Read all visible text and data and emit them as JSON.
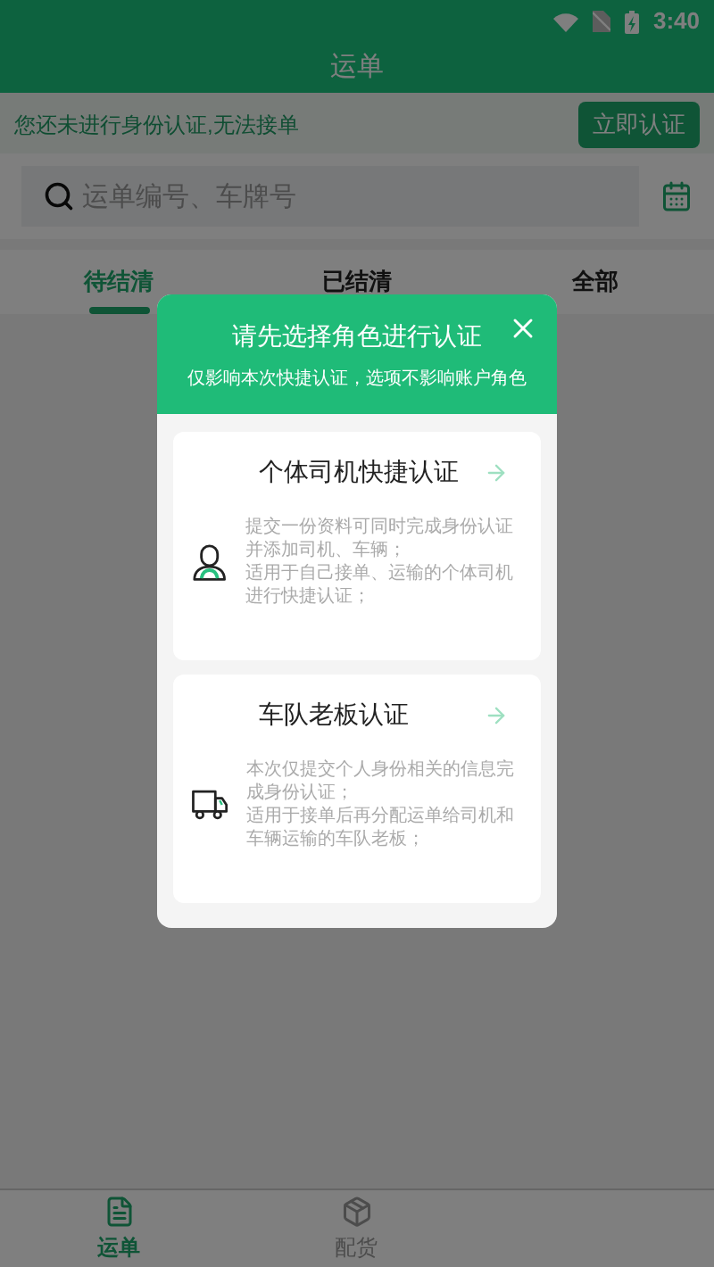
{
  "status_bar": {
    "time": "3:40"
  },
  "header": {
    "title": "运单"
  },
  "notice": {
    "text": "您还未进行身份认证,无法接单",
    "button": "立即认证"
  },
  "search": {
    "placeholder": "运单编号、车牌号"
  },
  "tabs": [
    {
      "label": "待结清",
      "selected": true
    },
    {
      "label": "已结清",
      "selected": false
    },
    {
      "label": "全部",
      "selected": false
    }
  ],
  "dialog": {
    "title": "请先选择角色进行认证",
    "subtitle": "仅影响本次快捷认证，选项不影响账户角色",
    "options": [
      {
        "kind": "driver",
        "title": "个体司机快捷认证",
        "description": [
          "提交一份资料可同时完成身份认证并添加司机、车辆；",
          "适用于自己接单、运输的个体司机进行快捷认证；"
        ]
      },
      {
        "kind": "fleet",
        "title": "车队老板认证",
        "description": [
          "本次仅提交个人身份相关的信息完成身份认证；",
          "适用于接单后再分配运单给司机和车辆运输的车队老板；"
        ]
      }
    ]
  },
  "bottom_nav": [
    {
      "kind": "waybill",
      "label": "运单",
      "selected": true
    },
    {
      "kind": "cargo",
      "label": "配货",
      "selected": false
    }
  ]
}
